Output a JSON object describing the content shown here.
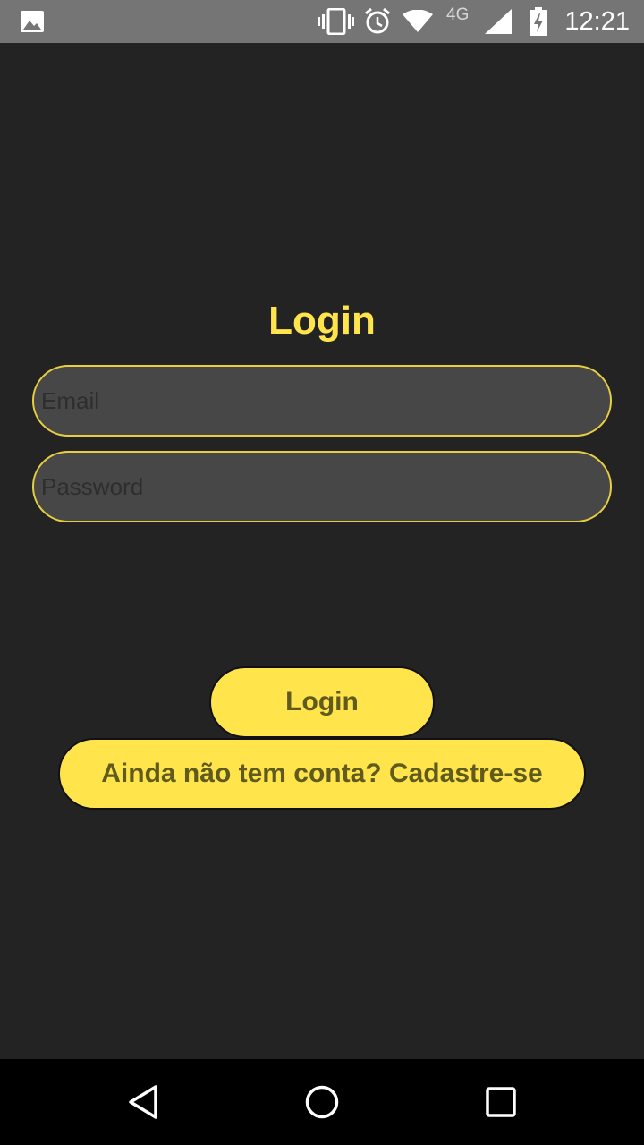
{
  "status_bar": {
    "time": "12:21",
    "network": "4G",
    "icons": [
      "image-icon",
      "vibrate-icon",
      "alarm-icon",
      "wifi-icon",
      "signal-icon",
      "battery-icon"
    ]
  },
  "login_form": {
    "title": "Login",
    "email_placeholder": "Email",
    "password_placeholder": "Password",
    "login_button": "Login",
    "signup_button": "Ainda não tem conta? Cadastre-se"
  },
  "nav_bar": {
    "icons": [
      "back-icon",
      "home-icon",
      "recents-icon"
    ]
  },
  "colors": {
    "background": "#232323",
    "accent": "#ffe44c",
    "field_background": "#474747",
    "button_text": "#5f5a1e"
  }
}
